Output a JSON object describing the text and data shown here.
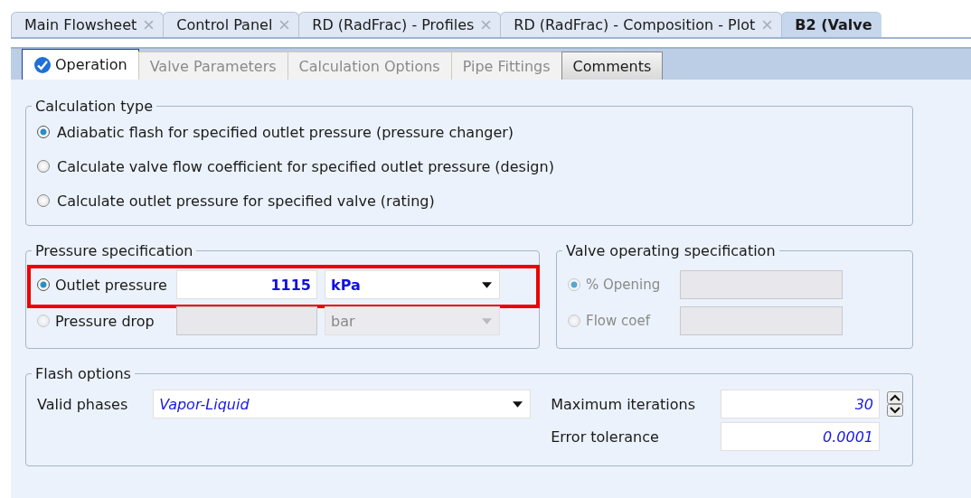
{
  "doc_tabs": [
    {
      "label": "Main Flowsheet",
      "selected": false,
      "closable": true
    },
    {
      "label": "Control Panel",
      "selected": false,
      "closable": true
    },
    {
      "label": "RD (RadFrac) - Profiles",
      "selected": false,
      "closable": true
    },
    {
      "label": "RD (RadFrac) - Composition - Plot",
      "selected": false,
      "closable": true
    },
    {
      "label": "B2 (Valve",
      "selected": true,
      "closable": false
    }
  ],
  "form_tabs": [
    {
      "label": "Operation",
      "selected": true,
      "disabled": false,
      "complete": true
    },
    {
      "label": "Valve Parameters",
      "selected": false,
      "disabled": true,
      "complete": false
    },
    {
      "label": "Calculation Options",
      "selected": false,
      "disabled": true,
      "complete": false
    },
    {
      "label": "Pipe Fittings",
      "selected": false,
      "disabled": true,
      "complete": false
    },
    {
      "label": "Comments",
      "selected": false,
      "disabled": false,
      "complete": false
    }
  ],
  "calculation_type": {
    "title": "Calculation type",
    "options": [
      {
        "label": "Adiabatic flash for specified outlet pressure (pressure changer)",
        "selected": true
      },
      {
        "label": "Calculate valve flow coefficient for specified outlet pressure (design)",
        "selected": false
      },
      {
        "label": "Calculate outlet pressure for specified valve (rating)",
        "selected": false
      }
    ]
  },
  "pressure_specification": {
    "title": "Pressure specification",
    "rows": [
      {
        "label": "Outlet pressure",
        "selected": true,
        "disabled": false,
        "highlighted": true,
        "value": "1115",
        "unit": "kPa"
      },
      {
        "label": "Pressure drop",
        "selected": false,
        "disabled": true,
        "highlighted": false,
        "unit": "bar"
      }
    ]
  },
  "valve_operating_specification": {
    "title": "Valve operating specification",
    "rows": [
      {
        "label": "% Opening",
        "selected": true,
        "disabled": true
      },
      {
        "label": "Flow coef",
        "selected": false,
        "disabled": true
      }
    ]
  },
  "flash_options": {
    "title": "Flash options",
    "valid_phases_label": "Valid phases",
    "valid_phases": "Vapor-Liquid",
    "max_iterations_label": "Maximum iterations",
    "max_iterations": "30",
    "error_tolerance_label": "Error tolerance",
    "error_tolerance": "0.0001"
  }
}
